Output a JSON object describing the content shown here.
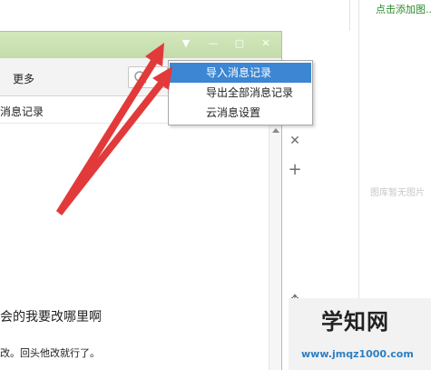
{
  "right_panel": {
    "add_link": "点击添加图...",
    "empty_text": "图库暂无图片"
  },
  "window": {
    "toolbar_more": "更多",
    "subheader_text": "消息记录"
  },
  "menu": {
    "items": [
      "导入消息记录",
      "导出全部消息记录",
      "云消息设置"
    ],
    "active_index": 0
  },
  "messages": [
    "会的我要改哪里啊",
    "改。回头他改就行了。"
  ],
  "watermark": {
    "mark": "学知网",
    "url": "www.jmqz1000.com"
  },
  "colors": {
    "titlebar": "#c8e0b1",
    "menu_highlight": "#3c86d3",
    "arrow": "#e23a3a",
    "link": "#2a8a2a"
  }
}
